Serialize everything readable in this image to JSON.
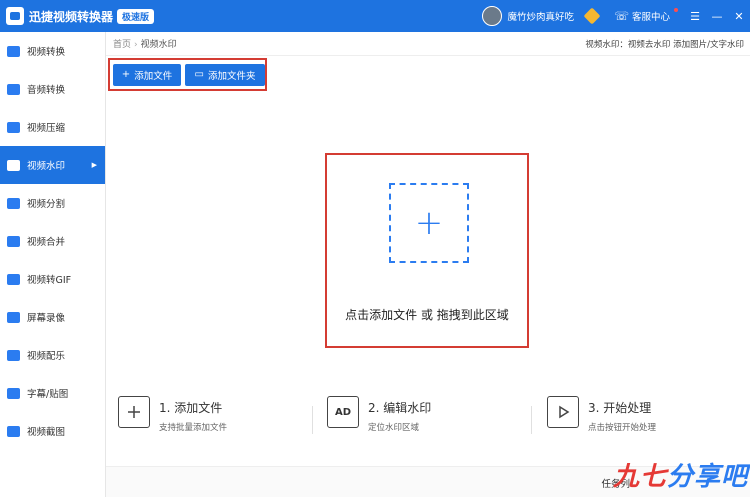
{
  "titlebar": {
    "app_title": "迅捷视频转换器",
    "edition": "极速版",
    "username": "魔竹炒肉真好吃",
    "service": "客服中心",
    "menu": "☰",
    "minimize": "—",
    "close": "✕"
  },
  "sidebar": {
    "items": [
      {
        "label": "视频转换"
      },
      {
        "label": "音频转换"
      },
      {
        "label": "视频压缩"
      },
      {
        "label": "视频水印"
      },
      {
        "label": "视频分割"
      },
      {
        "label": "视频合并"
      },
      {
        "label": "视频转GIF"
      },
      {
        "label": "屏幕录像"
      },
      {
        "label": "视频配乐"
      },
      {
        "label": "字幕/贴图"
      },
      {
        "label": "视频截图"
      }
    ],
    "active_index": 3
  },
  "breadcrumb": {
    "home": "首页",
    "sep": "›",
    "current": "视频水印"
  },
  "right_hint": "视频水印：视频去水印 添加图片/文字水印",
  "toolbar": {
    "add_file": "添加文件",
    "add_folder": "添加文件夹"
  },
  "dropzone": {
    "text": "点击添加文件 或 拖拽到此区域"
  },
  "steps": [
    {
      "title": "1. 添加文件",
      "sub": "支持批量添加文件",
      "icon_text": ""
    },
    {
      "title": "2. 编辑水印",
      "sub": "定位水印区域",
      "icon_text": "AD"
    },
    {
      "title": "3. 开始处理",
      "sub": "点击按钮开始处理",
      "icon_text": ""
    }
  ],
  "bottom": {
    "tasks_label": "任务列",
    "watermark_a": "九七",
    "watermark_b": "分享吧"
  },
  "colors": {
    "primary": "#1e73e0",
    "highlight_border": "#d43c33",
    "dashed": "#2b7cf0"
  }
}
